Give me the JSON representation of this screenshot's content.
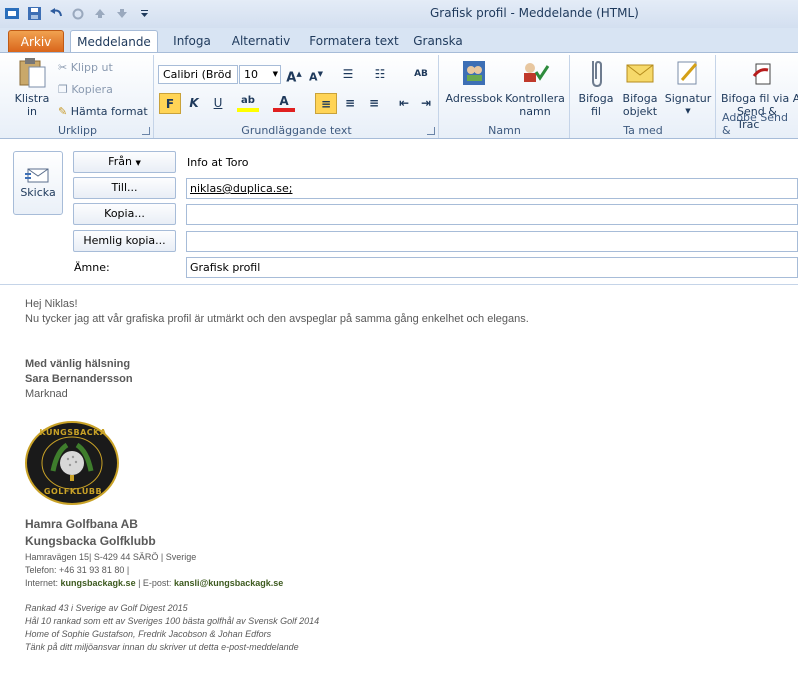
{
  "window": {
    "title": "Grafisk profil  -  Meddelande (HTML)"
  },
  "tabs": [
    "Arkiv",
    "Meddelande",
    "Infoga",
    "Alternativ",
    "Formatera text",
    "Granska"
  ],
  "ribbon": {
    "clipboard": {
      "paste": "Klistra",
      "paste2": "in",
      "cut": "Klipp ut",
      "copy": "Kopiera",
      "format_painter": "Hämta format",
      "label": "Urklipp"
    },
    "font": {
      "font_name": "Calibri (Bröd",
      "font_size": "10",
      "bold": "F",
      "italic": "K",
      "underline": "U",
      "label": "Grundläggande text"
    },
    "names": {
      "address_book": "Adressbok",
      "check_names_1": "Kontrollera",
      "check_names_2": "namn",
      "label": "Namn"
    },
    "include": {
      "attach_file_1": "Bifoga",
      "attach_file_2": "fil",
      "attach_item_1": "Bifoga",
      "attach_item_2": "objekt",
      "signature": "Signatur",
      "label": "Ta med"
    },
    "adobe": {
      "line1": "Bifoga fil via A",
      "line2": "Send & Trac",
      "label": "Adobe Send &"
    }
  },
  "header": {
    "send": "Skicka",
    "from_btn": "Från",
    "from_value": "Info at Toro",
    "to_btn": "Till...",
    "to_value": "niklas@duplica.se;",
    "cc_btn": "Kopia...",
    "bcc_btn": "Hemlig kopia...",
    "subject_label": "Ämne:",
    "subject_value": "Grafisk profil"
  },
  "body": {
    "greeting": "Hej Niklas!",
    "text": "Nu tycker jag att vår grafiska profil är utmärkt och den avspeglar på samma gång enkelhet och elegans.",
    "regards": "Med vänlig hälsning",
    "name": "Sara Bernandersson",
    "dept": "Marknad",
    "logo_top": "KUNGSBACKA",
    "logo_bottom": "GOLFKLUBB",
    "company1": "Hamra Golfbana AB",
    "company2": "Kungsbacka Golfklubb",
    "address": "Hamravägen 15| S-429 44 SÄRÖ | Sverige",
    "phone": "Telefon: +46 31 93 81 80 |",
    "internet_label": "Internet: ",
    "internet": "kungsbackagk.se",
    "email_label": " | E-post: ",
    "email": "kansli@kungsbackagk.se",
    "line1": "Rankad 43 i Sverige av Golf Digest 2015",
    "line2": "Hål 10 rankad som ett av Sveriges 100 bästa golfhål av Svensk Golf 2014",
    "line3": "Home of Sophie Gustafson, Fredrik Jacobson & Johan Edfors",
    "line4": "Tänk på ditt miljöansvar innan du skriver ut detta e-post-meddelande"
  }
}
